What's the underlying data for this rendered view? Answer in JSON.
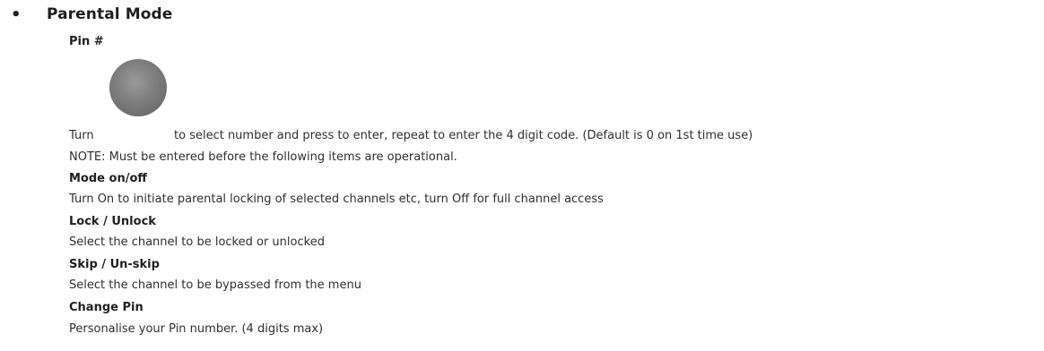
{
  "section": {
    "bullet": "•",
    "title": "Parental Mode"
  },
  "pin": {
    "heading": "Pin #",
    "turn_word": "Turn",
    "instruction": "to select number and press to enter, repeat to enter the 4 digit code. (Default is 0 on 1st time use)",
    "knob_icon": "rotary-knob-icon",
    "note": "NOTE: Must be entered before the following items are operational."
  },
  "mode": {
    "heading": "Mode on/off",
    "text": "Turn On to initiate parental locking of selected channels etc, turn Off for full channel access"
  },
  "lock": {
    "heading": "Lock / Unlock",
    "text": "Select the channel to be locked or unlocked"
  },
  "skip": {
    "heading": "Skip / Un-skip",
    "text": "Select the channel to be bypassed from the menu"
  },
  "change_pin": {
    "heading": "Change Pin",
    "text": "Personalise your Pin number. (4 digits max)"
  }
}
